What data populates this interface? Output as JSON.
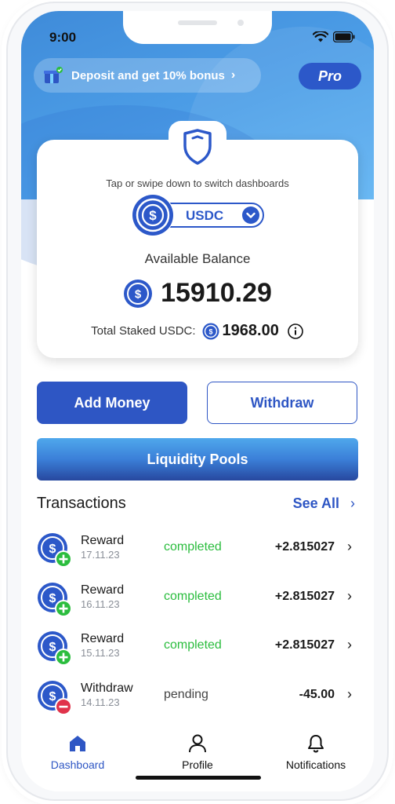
{
  "status_bar": {
    "time": "9:00"
  },
  "header": {
    "bonus_text": "Deposit and get 10% bonus",
    "pro_label": "Pro"
  },
  "card": {
    "hint": "Tap or swipe down to switch dashboards",
    "currency": "USDC",
    "available_label": "Available Balance",
    "balance": "15910.29",
    "staked_label": "Total Staked USDC:",
    "staked_value": "1968.00"
  },
  "actions": {
    "add_money": "Add Money",
    "withdraw": "Withdraw",
    "liquidity_pools": "Liquidity Pools"
  },
  "transactions": {
    "title": "Transactions",
    "see_all": "See All",
    "items": [
      {
        "title": "Reward",
        "date": "17.11.23",
        "status": "completed",
        "amount": "+2.815027",
        "kind": "plus"
      },
      {
        "title": "Reward",
        "date": "16.11.23",
        "status": "completed",
        "amount": "+2.815027",
        "kind": "plus"
      },
      {
        "title": "Reward",
        "date": "15.11.23",
        "status": "completed",
        "amount": "+2.815027",
        "kind": "plus"
      },
      {
        "title": "Withdraw",
        "date": "14.11.23",
        "status": "pending",
        "amount": "-45.00",
        "kind": "minus"
      }
    ]
  },
  "tabbar": {
    "dashboard": "Dashboard",
    "profile": "Profile",
    "notifications": "Notifications"
  },
  "colors": {
    "brand_blue": "#2e56c4",
    "completed_green": "#2bbd3e",
    "minus_red": "#e0334b"
  }
}
